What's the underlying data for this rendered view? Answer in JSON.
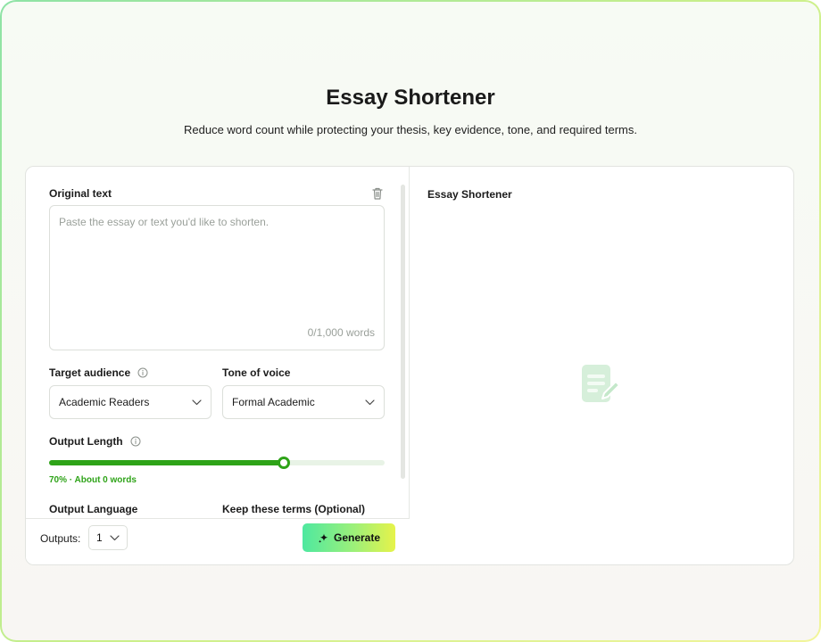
{
  "header": {
    "title": "Essay Shortener",
    "subtitle": "Reduce word count while protecting your thesis, key evidence, tone, and required terms."
  },
  "input": {
    "label": "Original text",
    "placeholder": "Paste the essay or text you'd like to shorten.",
    "value": "",
    "word_count": "0/1,000 words"
  },
  "audience": {
    "label": "Target audience",
    "selected": "Academic Readers"
  },
  "tone": {
    "label": "Tone of voice",
    "selected": "Formal Academic"
  },
  "length": {
    "label": "Output Length",
    "percent": 70,
    "value_text": "70% · About 0 words"
  },
  "language": {
    "label": "Output Language"
  },
  "keep_terms": {
    "label": "Keep these terms (Optional)"
  },
  "footer": {
    "outputs_label": "Outputs:",
    "outputs_value": "1",
    "generate_label": "Generate"
  },
  "output_panel": {
    "title": "Essay Shortener"
  },
  "icons": [
    "trash-icon",
    "info-icon",
    "chevron-down-icon",
    "sparkle-icon",
    "document-edit-icon"
  ],
  "colors": {
    "accent": "#2ea318",
    "accent_light": "#e8f3e6",
    "placeholder_icon": "#d8efdc"
  }
}
